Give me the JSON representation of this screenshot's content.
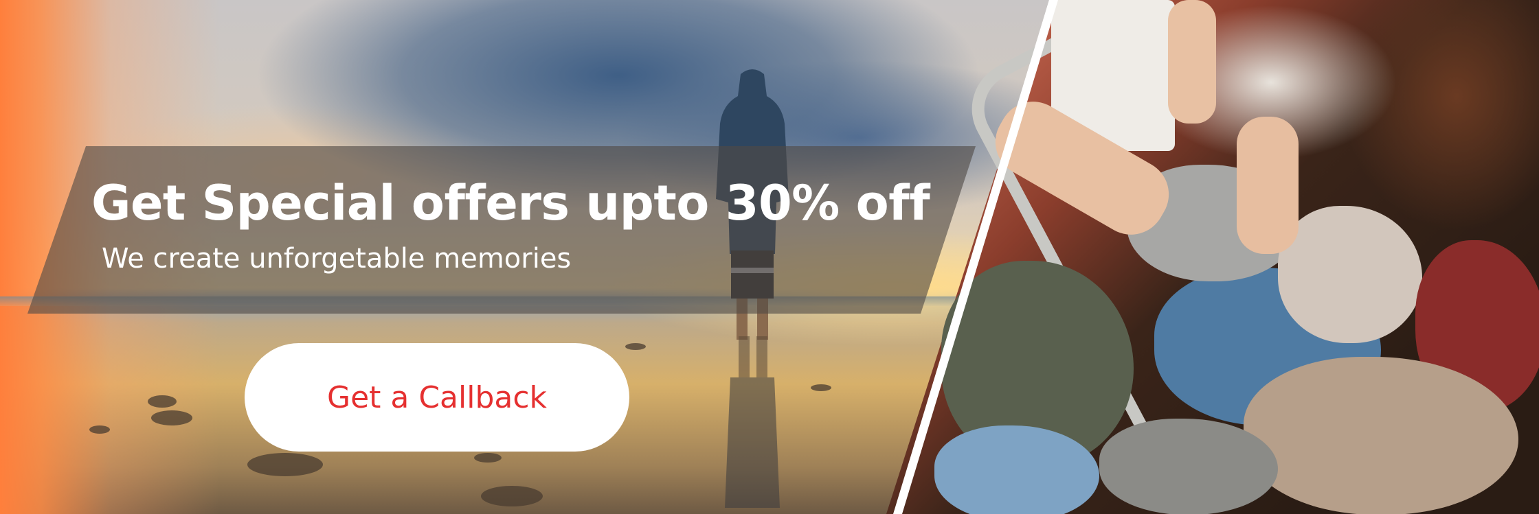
{
  "banner": {
    "headline": "Get Special offers upto 30% off",
    "subheadline": "We create unforgetable memories",
    "cta_label": "Get a Callback"
  },
  "colors": {
    "accent_orange": "#ff7f3c",
    "cta_text": "#e53030",
    "cta_background": "#ffffff",
    "band_overlay": "#504a46"
  },
  "images": {
    "left": "person-on-beach-at-sunset-photo",
    "right": "packing-clothes-in-suitcase-photo"
  }
}
